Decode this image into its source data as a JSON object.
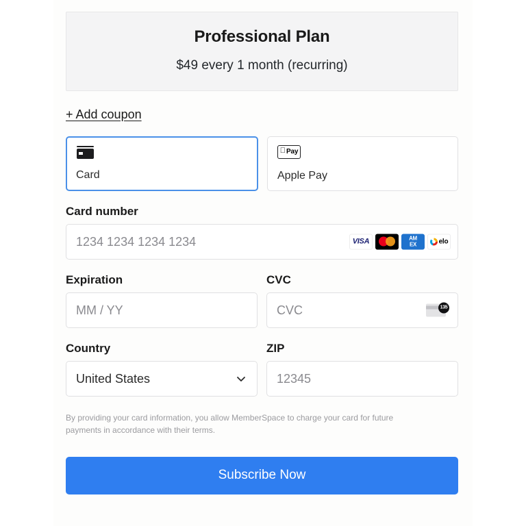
{
  "plan": {
    "title": "Professional Plan",
    "price_line": "$49 every 1 month (recurring)"
  },
  "coupon": {
    "link_label": "+ Add coupon"
  },
  "payment_methods": [
    {
      "label": "Card",
      "icon": "credit-card-icon",
      "selected": true
    },
    {
      "label": "Apple Pay",
      "icon": "apple-pay-icon",
      "selected": false
    }
  ],
  "apple_pay_glyph": {
    "apple": "",
    "pay": "Pay"
  },
  "fields": {
    "card_number": {
      "label": "Card number",
      "placeholder": "1234 1234 1234 1234",
      "value": ""
    },
    "expiration": {
      "label": "Expiration",
      "placeholder": "MM / YY",
      "value": ""
    },
    "cvc": {
      "label": "CVC",
      "placeholder": "CVC",
      "value": "",
      "hint_badge": "135"
    },
    "country": {
      "label": "Country",
      "value": "United States"
    },
    "zip": {
      "label": "ZIP",
      "placeholder": "12345",
      "value": ""
    }
  },
  "card_brands": [
    {
      "name": "visa",
      "text": "VISA"
    },
    {
      "name": "mastercard",
      "text": ""
    },
    {
      "name": "amex",
      "text_line1": "AM",
      "text_line2": "EX"
    },
    {
      "name": "elo",
      "text": "elo"
    }
  ],
  "disclaimer": "By providing your card information, you allow MemberSpace to charge your card for future payments in accordance with their terms.",
  "submit": {
    "label": "Subscribe Now"
  },
  "colors": {
    "accent_blue": "#2f7ef0",
    "selected_border": "#4a90e8",
    "header_bg": "#f4f4f5",
    "placeholder_text": "#8a8a8f"
  }
}
